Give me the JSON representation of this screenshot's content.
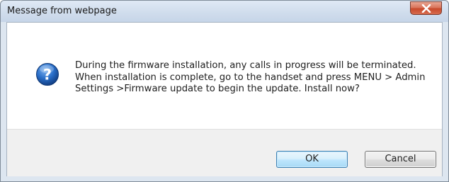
{
  "window": {
    "title": "Message from webpage",
    "close_icon": "close-icon"
  },
  "dialog": {
    "icon": "question-icon",
    "message": "During the firmware installation, any calls in progress will be terminated. When installation is complete, go to the handset and press MENU > Admin Settings >Firmware update to begin the update. Install now?"
  },
  "buttons": {
    "ok_label": "OK",
    "cancel_label": "Cancel"
  },
  "colors": {
    "close_button": "#c94a2c",
    "question_icon": "#1f5fb5",
    "ok_border": "#3c7fb1"
  }
}
